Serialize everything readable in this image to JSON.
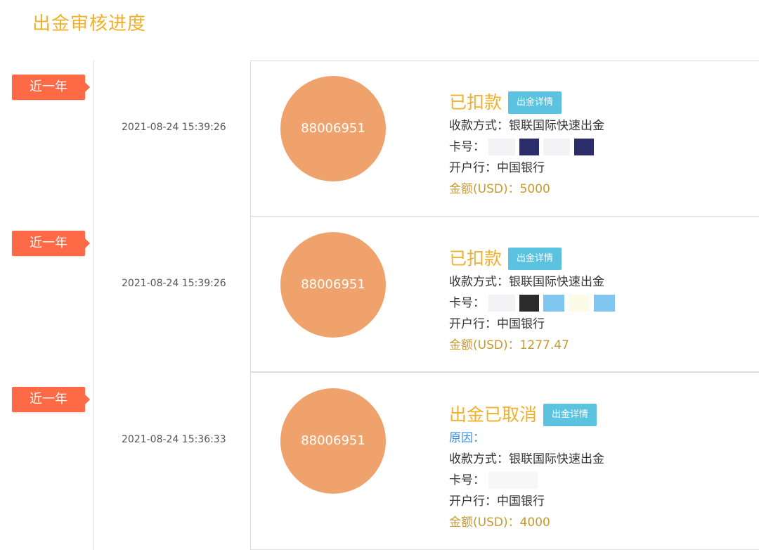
{
  "page": {
    "title": "出金审核进度"
  },
  "colors": {
    "title": "#f1b02b",
    "tag_bg": "#ff6a46",
    "circle_bg": "#f0a26c",
    "button_bg": "#5bc2e0",
    "amount": "#c69a2d",
    "reason": "#3d8ee0"
  },
  "records": [
    {
      "tag": "近一年",
      "time": "2021-08-24 15:39:26",
      "account": "88006951",
      "status": "已扣款",
      "detail_button": "出金详情",
      "method_label": "收款方式：",
      "method_value": "银联国际快速出金",
      "card_label": "卡号：",
      "bank_label": "开户行：",
      "bank_value": "中国银行",
      "amount_label": "金额(USD)：",
      "amount_value": "5000"
    },
    {
      "tag": "近一年",
      "time": "2021-08-24 15:39:26",
      "account": "88006951",
      "status": "已扣款",
      "detail_button": "出金详情",
      "method_label": "收款方式：",
      "method_value": "银联国际快速出金",
      "card_label": "卡号：",
      "bank_label": "开户行：",
      "bank_value": "中国银行",
      "amount_label": "金额(USD)：",
      "amount_value": "1277.47"
    },
    {
      "tag": "近一年",
      "time": "2021-08-24 15:36:33",
      "account": "88006951",
      "status": "出金已取消",
      "detail_button": "出金详情",
      "reason_label": "原因：",
      "method_label": "收款方式：",
      "method_value": "银联国际快速出金",
      "card_label": "卡号：",
      "bank_label": "开户行：",
      "bank_value": "中国银行",
      "amount_label": "金额(USD)：",
      "amount_value": "4000"
    }
  ]
}
